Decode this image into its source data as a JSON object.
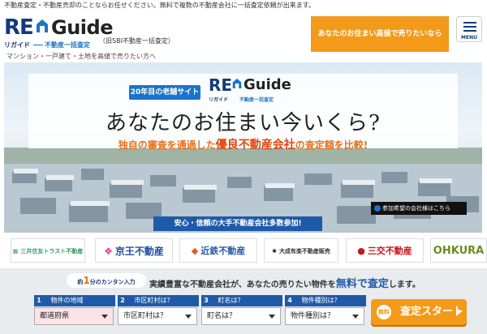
{
  "top_note": "不動産査定・不動産売却のことならお任せください。無料で複数の不動産会社に一括査定依頼が出来ます。",
  "logo": {
    "re": "RE",
    "guide": "Guide",
    "sub_kana": "リガイド",
    "sub_tagline": "不動産一括査定"
  },
  "former_name": "（旧SBI不動産一括査定）",
  "header_cta": "あなたのお住まい高値で売りたいなら",
  "menu_label": "MENU",
  "tagline": "マンション・一戸建て・土地を高値で売りたい方へ",
  "hero": {
    "badge": "20年目の老舗サイト",
    "headline": "あなたのお住まい今いくら?",
    "subhead_pre": "独自の審査を通過した",
    "subhead_em": "優良不動産会社",
    "subhead_post": "の査定額を比較!",
    "trust_banner": "安心・信頼の大手不動産会社多数参加!",
    "photo_caption": "参加希望の会社様はこちら"
  },
  "brands": [
    {
      "name": "三井住友トラスト不動産",
      "color": "#2f9b63"
    },
    {
      "name": "京王不動産",
      "color": "#1f4ea3"
    },
    {
      "name": "近鉄不動産",
      "color": "#2a5aa8"
    },
    {
      "name": "大成有楽不動産販売",
      "color": "#333333"
    },
    {
      "name": "三交不動産",
      "color": "#c8161d"
    },
    {
      "name": "OHKURA",
      "color": "#6d8b1f"
    }
  ],
  "form": {
    "intro_pre": "約",
    "intro_num": "1",
    "intro_post": "分のカンタン入力",
    "lead_pre": "実績豊富な不動産会社が、あなたの売りたい物件を",
    "lead_free": "無料で査定",
    "lead_post": "します。",
    "steps": [
      {
        "num": "1",
        "label": "物件の地域",
        "value": "都道府県"
      },
      {
        "num": "2",
        "label": "市区町村は？",
        "value": "市区町村は？"
      },
      {
        "num": "3",
        "label": "町名は？",
        "value": "町名は？"
      },
      {
        "num": "4",
        "label": "物件種別は？",
        "value": "物件種別は？"
      }
    ],
    "submit_badge": "無料",
    "submit_label": "査定スタート"
  }
}
